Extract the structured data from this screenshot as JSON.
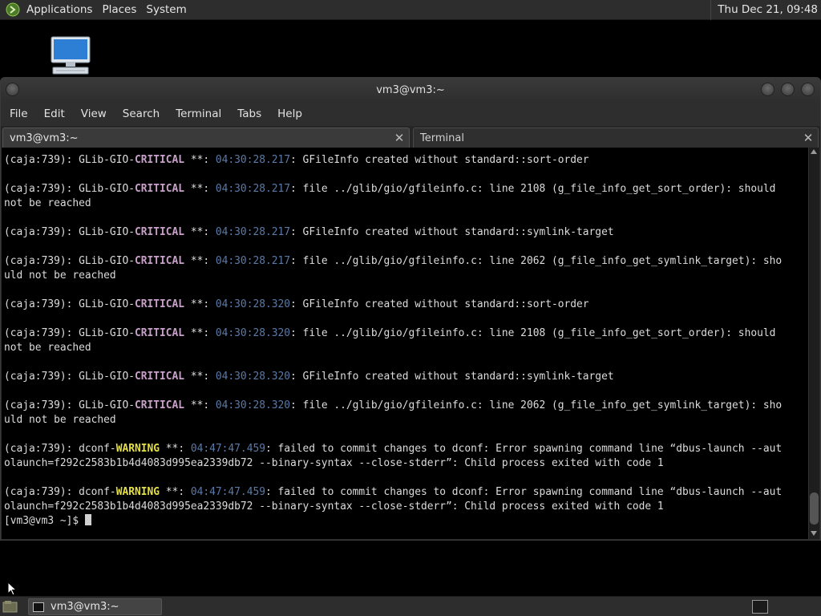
{
  "top_panel": {
    "menus": [
      "Applications",
      "Places",
      "System"
    ],
    "clock": "Thu Dec 21, 09:48"
  },
  "desktop": {
    "icon": "computer-icon"
  },
  "window": {
    "title": "vm3@vm3:~",
    "menus": [
      "File",
      "Edit",
      "View",
      "Search",
      "Terminal",
      "Tabs",
      "Help"
    ],
    "tabs": [
      {
        "label": "vm3@vm3:~",
        "active": true
      },
      {
        "label": "Terminal",
        "active": false
      }
    ]
  },
  "terminal": {
    "lines": [
      {
        "parts": [
          [
            "(caja:739): GLib-GIO-",
            ""
          ],
          [
            "CRITICAL",
            "crit"
          ],
          [
            " **: ",
            ""
          ],
          [
            "04:30:28.217",
            "ts"
          ],
          [
            ": GFileInfo created without standard::sort-order",
            ""
          ]
        ]
      },
      {
        "parts": [
          [
            "",
            ""
          ]
        ]
      },
      {
        "parts": [
          [
            "(caja:739): GLib-GIO-",
            ""
          ],
          [
            "CRITICAL",
            "crit"
          ],
          [
            " **: ",
            ""
          ],
          [
            "04:30:28.217",
            "ts"
          ],
          [
            ": file ../glib/gio/gfileinfo.c: line 2108 (g_file_info_get_sort_order): should",
            ""
          ]
        ]
      },
      {
        "parts": [
          [
            "not be reached",
            ""
          ]
        ]
      },
      {
        "parts": [
          [
            "",
            ""
          ]
        ]
      },
      {
        "parts": [
          [
            "(caja:739): GLib-GIO-",
            ""
          ],
          [
            "CRITICAL",
            "crit"
          ],
          [
            " **: ",
            ""
          ],
          [
            "04:30:28.217",
            "ts"
          ],
          [
            ": GFileInfo created without standard::symlink-target",
            ""
          ]
        ]
      },
      {
        "parts": [
          [
            "",
            ""
          ]
        ]
      },
      {
        "parts": [
          [
            "(caja:739): GLib-GIO-",
            ""
          ],
          [
            "CRITICAL",
            "crit"
          ],
          [
            " **: ",
            ""
          ],
          [
            "04:30:28.217",
            "ts"
          ],
          [
            ": file ../glib/gio/gfileinfo.c: line 2062 (g_file_info_get_symlink_target): sho",
            ""
          ]
        ]
      },
      {
        "parts": [
          [
            "uld not be reached",
            ""
          ]
        ]
      },
      {
        "parts": [
          [
            "",
            ""
          ]
        ]
      },
      {
        "parts": [
          [
            "(caja:739): GLib-GIO-",
            ""
          ],
          [
            "CRITICAL",
            "crit"
          ],
          [
            " **: ",
            ""
          ],
          [
            "04:30:28.320",
            "ts"
          ],
          [
            ": GFileInfo created without standard::sort-order",
            ""
          ]
        ]
      },
      {
        "parts": [
          [
            "",
            ""
          ]
        ]
      },
      {
        "parts": [
          [
            "(caja:739): GLib-GIO-",
            ""
          ],
          [
            "CRITICAL",
            "crit"
          ],
          [
            " **: ",
            ""
          ],
          [
            "04:30:28.320",
            "ts"
          ],
          [
            ": file ../glib/gio/gfileinfo.c: line 2108 (g_file_info_get_sort_order): should",
            ""
          ]
        ]
      },
      {
        "parts": [
          [
            "not be reached",
            ""
          ]
        ]
      },
      {
        "parts": [
          [
            "",
            ""
          ]
        ]
      },
      {
        "parts": [
          [
            "(caja:739): GLib-GIO-",
            ""
          ],
          [
            "CRITICAL",
            "crit"
          ],
          [
            " **: ",
            ""
          ],
          [
            "04:30:28.320",
            "ts"
          ],
          [
            ": GFileInfo created without standard::symlink-target",
            ""
          ]
        ]
      },
      {
        "parts": [
          [
            "",
            ""
          ]
        ]
      },
      {
        "parts": [
          [
            "(caja:739): GLib-GIO-",
            ""
          ],
          [
            "CRITICAL",
            "crit"
          ],
          [
            " **: ",
            ""
          ],
          [
            "04:30:28.320",
            "ts"
          ],
          [
            ": file ../glib/gio/gfileinfo.c: line 2062 (g_file_info_get_symlink_target): sho",
            ""
          ]
        ]
      },
      {
        "parts": [
          [
            "uld not be reached",
            ""
          ]
        ]
      },
      {
        "parts": [
          [
            "",
            ""
          ]
        ]
      },
      {
        "parts": [
          [
            "(caja:739): dconf-",
            ""
          ],
          [
            "WARNING",
            "warn"
          ],
          [
            " **: ",
            ""
          ],
          [
            "04:47:47.459",
            "ts"
          ],
          [
            ": failed to commit changes to dconf: Error spawning command line “dbus-launch --aut",
            ""
          ]
        ]
      },
      {
        "parts": [
          [
            "olaunch=f292c2583b1b4d4083d995ea2339db72 --binary-syntax --close-stderr”: Child process exited with code 1",
            ""
          ]
        ]
      },
      {
        "parts": [
          [
            "",
            ""
          ]
        ]
      },
      {
        "parts": [
          [
            "(caja:739): dconf-",
            ""
          ],
          [
            "WARNING",
            "warn"
          ],
          [
            " **: ",
            ""
          ],
          [
            "04:47:47.459",
            "ts"
          ],
          [
            ": failed to commit changes to dconf: Error spawning command line “dbus-launch --aut",
            ""
          ]
        ]
      },
      {
        "parts": [
          [
            "olaunch=f292c2583b1b4d4083d995ea2339db72 --binary-syntax --close-stderr”: Child process exited with code 1",
            ""
          ]
        ]
      },
      {
        "parts": [
          [
            "[vm3@vm3 ~]$ ",
            ""
          ]
        ]
      }
    ]
  },
  "taskbar": {
    "task_label": "vm3@vm3:~"
  },
  "colors": {
    "critical": "#c9a0c9",
    "warning": "#e5e040",
    "timestamp": "#5a7aa8"
  }
}
